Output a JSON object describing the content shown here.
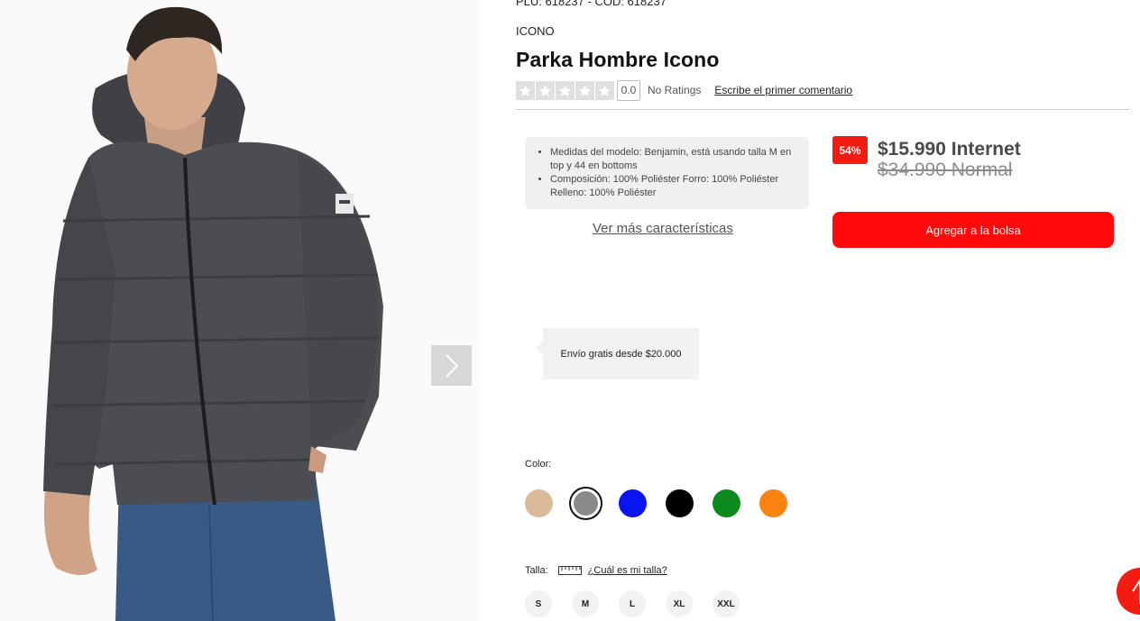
{
  "product": {
    "plu_cod": "PLU: 618237 - COD: 618237",
    "brand": "ICONO",
    "title": "Parka Hombre Icono",
    "rating_score": "0.0",
    "no_ratings": "No Ratings",
    "write_review": "Escribe el primer comentario",
    "rating_stars": 0
  },
  "features": [
    "Medidas del modelo: Benjamin, está usando talla M en top y 44 en bottoms",
    "Composición: 100% Poliéster Forro: 100% Poliéster Relleno: 100% Poliéster"
  ],
  "see_more": "Ver más características",
  "pricing": {
    "discount": "54%",
    "internet": "$15.990 Internet",
    "normal": "$34.990 Normal"
  },
  "add_to_bag": "Agregar a la bolsa",
  "shipping_tip": "Envío gratis desde $20.000",
  "color": {
    "label": "Color:",
    "swatches": [
      {
        "name": "beige",
        "hex": "#d9bb98"
      },
      {
        "name": "gris",
        "hex": "#8a8a8a",
        "selected": true
      },
      {
        "name": "azul",
        "hex": "#0a14f2"
      },
      {
        "name": "negro",
        "hex": "#000000"
      },
      {
        "name": "verde",
        "hex": "#0d8a1e"
      },
      {
        "name": "naranjo",
        "hex": "#fb8411"
      }
    ]
  },
  "size": {
    "label": "Talla:",
    "guide": "¿Cuál es mi talla?",
    "options": [
      "S",
      "M",
      "L",
      "XL",
      "XXL"
    ]
  },
  "colors": {
    "accent_red": "#f41b12",
    "button_red": "#ff0a0a",
    "jacket": "#4b4d52",
    "jeans": "#3a5a86"
  },
  "icons": {
    "next": "chevron-right-icon",
    "ruler": "ruler-icon",
    "scroll_top": "arrow-up-icon",
    "star": "star-icon"
  }
}
